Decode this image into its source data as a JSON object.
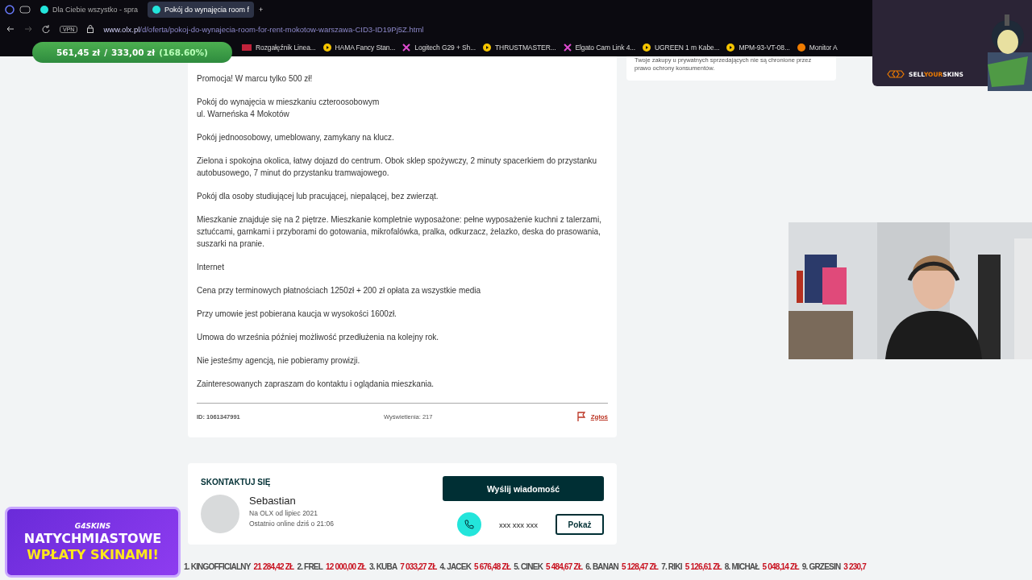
{
  "browser": {
    "tabs": [
      {
        "title": "Dla Ciebie wszystko - spra",
        "selected": false
      },
      {
        "title": "Pokój do wynajęcia room f",
        "selected": true
      }
    ],
    "new_tab": "+",
    "address_bar": {
      "host": "www.olx.pl",
      "path": "/d/oferta/pokoj-do-wynajecia-room-for-rent-mokotow-warszawa-CID3-ID19Pj5Z.html",
      "vpn": "VPN"
    },
    "bookmarks": [
      {
        "label": "Rozgałęźnik Linea...",
        "kind": "lsa"
      },
      {
        "label": "HAMA Fancy Stan...",
        "kind": "play"
      },
      {
        "label": "Logitech G29 + Sh...",
        "kind": "cross"
      },
      {
        "label": "THRUSTMASTER...",
        "kind": "play"
      },
      {
        "label": "Elgato Cam Link 4...",
        "kind": "cross"
      },
      {
        "label": "UGREEN 1 m Kabe...",
        "kind": "play"
      },
      {
        "label": "MPM-93-VT-08...",
        "kind": "play"
      },
      {
        "label": "Monitor A",
        "kind": "e"
      }
    ]
  },
  "price_overlay": {
    "current": "561,45 zł",
    "separator": "/",
    "total": "333,00 zł",
    "change": "(168.60%)"
  },
  "listing": {
    "paragraphs": [
      "Promocja! W marcu tylko 500 zł!",
      "Pokój do wynajęcia w mieszkaniu czteroosobowym\nul. Warneńska 4 Mokotów",
      "Pokój jednoosobowy, umeblowany, zamykany na klucz.",
      "Zielona i spokojna okolica, łatwy dojazd do centrum. Obok sklep spożywczy, 2 minuty spacerkiem do przystanku autobusowego, 7 minut do przystanku tramwajowego.",
      "Pokój dla osoby studiującej lub pracującej, niepalącej, bez zwierząt.",
      "Mieszkanie znajduje się na 2 piętrze. Mieszkanie kompletnie wyposażone: pełne wyposażenie kuchni z talerzami, sztućcami, garnkami i przyborami do gotowania, mikrofalówka, pralka, odkurzacz, żelazko, deska do prasowania, suszarki na pranie.",
      "Internet",
      "Cena przy terminowych płatnościach 1250zł + 200 zł opłata za wszystkie media",
      "Przy umowie jest pobierana kaucja w wysokości 1600zł.",
      "Umowa do września później możliwość przedłużenia na kolejny rok.",
      "Nie jesteśmy agencją, nie pobieramy prowizji.",
      "Zainteresowanych zapraszam do kontaktu i oglądania mieszkania."
    ],
    "id": "ID: 1061347991",
    "views": "Wyświetlenia: 217",
    "report": "Zgłoś"
  },
  "contact": {
    "heading": "SKONTAKTUJ SIĘ",
    "name": "Sebastian",
    "since": "Na OLX od lipiec 2021",
    "online": "Ostatnio online dziś o 21:06",
    "send_button": "Wyślij wiadomość",
    "phone": "xxx xxx xxx",
    "show_button": "Pokaż"
  },
  "side_note": "Twoje zakupy u prywatnych sprzedających nie są chronione przez prawo ochrony konsumentów.",
  "sponsor_panel": {
    "brand_parts": [
      {
        "text": "SELL",
        "highlight": false
      },
      {
        "text": "YOUR",
        "highlight": true
      },
      {
        "text": "SKINS",
        "highlight": false
      }
    ]
  },
  "banner": {
    "brand": "G4SKINS",
    "line1": "NATYCHMIASTOWE",
    "line2": "WPŁATY SKINAMI!"
  },
  "ticker": [
    {
      "name": "1. KINGOFFICIALNY",
      "amount": "21 284,42 ZŁ"
    },
    {
      "name": "2. FREL",
      "amount": "12 000,00 ZŁ"
    },
    {
      "name": "3. KUBA",
      "amount": "7 033,27 ZŁ"
    },
    {
      "name": "4. JACEK",
      "amount": "5 676,48 ZŁ"
    },
    {
      "name": "5. CINEK",
      "amount": "5 484,67 ZŁ"
    },
    {
      "name": "6. BANAN",
      "amount": "5 128,47 ZŁ"
    },
    {
      "name": "7. RIKI",
      "amount": "5 126,61 ZŁ"
    },
    {
      "name": "8. MICHAŁ",
      "amount": "5 048,14 ZŁ"
    },
    {
      "name": "9. GRZESIN",
      "amount": "3 230,7"
    }
  ]
}
